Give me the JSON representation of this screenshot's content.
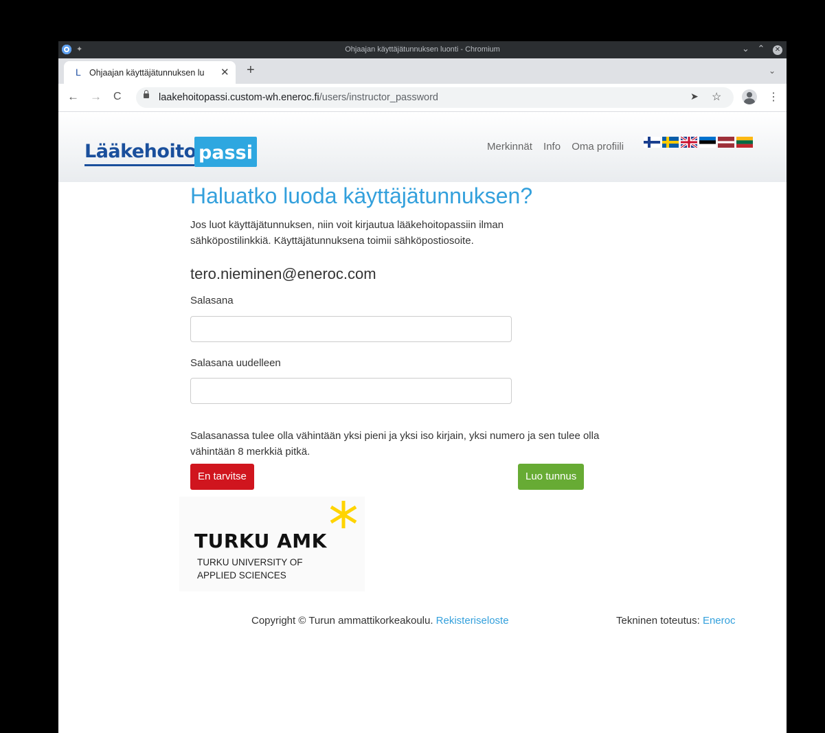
{
  "window": {
    "title": "Ohjaajan käyttäjätunnuksen luonti - Chromium"
  },
  "tab": {
    "favicon_letter": "L",
    "title": "Ohjaajan käyttäjätunnuksen lu"
  },
  "address_bar": {
    "host": "laakehoitopassi.custom-wh.eneroc.fi",
    "path": "/users/instructor_password"
  },
  "header": {
    "logo_part1": "Lääkehoito",
    "logo_part2": "passi",
    "nav": [
      "Merkinnät",
      "Info",
      "Oma profiili"
    ],
    "flags": [
      "fi",
      "se",
      "gb",
      "ee",
      "lv",
      "lt"
    ]
  },
  "form": {
    "heading": "Haluatko luoda käyttäjätunnuksen?",
    "intro": "Jos luot käyttäjätunnuksen, niin voit kirjautua lääkehoitopassiin ilman sähköpostilinkkiä. Käyttäjätunnuksena toimii sähköpostiosoite.",
    "email": "tero.nieminen@eneroc.com",
    "password_label": "Salasana",
    "password_value": "",
    "password_again_label": "Salasana uudelleen",
    "password_again_value": "",
    "help": "Salasanassa tulee olla vähintään yksi pieni ja yksi iso kirjain, yksi numero ja sen tulee olla vähintään 8 merkkiä pitkä.",
    "decline_button": "En tarvitse",
    "create_button": "Luo tunnus"
  },
  "partner": {
    "name": "TURKU AMK",
    "line1": "TURKU UNIVERSITY OF",
    "line2": "APPLIED SCIENCES"
  },
  "footer": {
    "copyright": "Copyright © Turun ammattikorkeakoulu.",
    "privacy_link": "Rekisteriseloste",
    "tech_label": "Tekninen toteutus:",
    "tech_link": "Eneroc"
  },
  "colors": {
    "accent": "#33a0dc",
    "danger": "#d0151e",
    "success": "#67ab34",
    "logo_dark": "#1a4f9c",
    "turku_yellow": "#ffd400"
  }
}
